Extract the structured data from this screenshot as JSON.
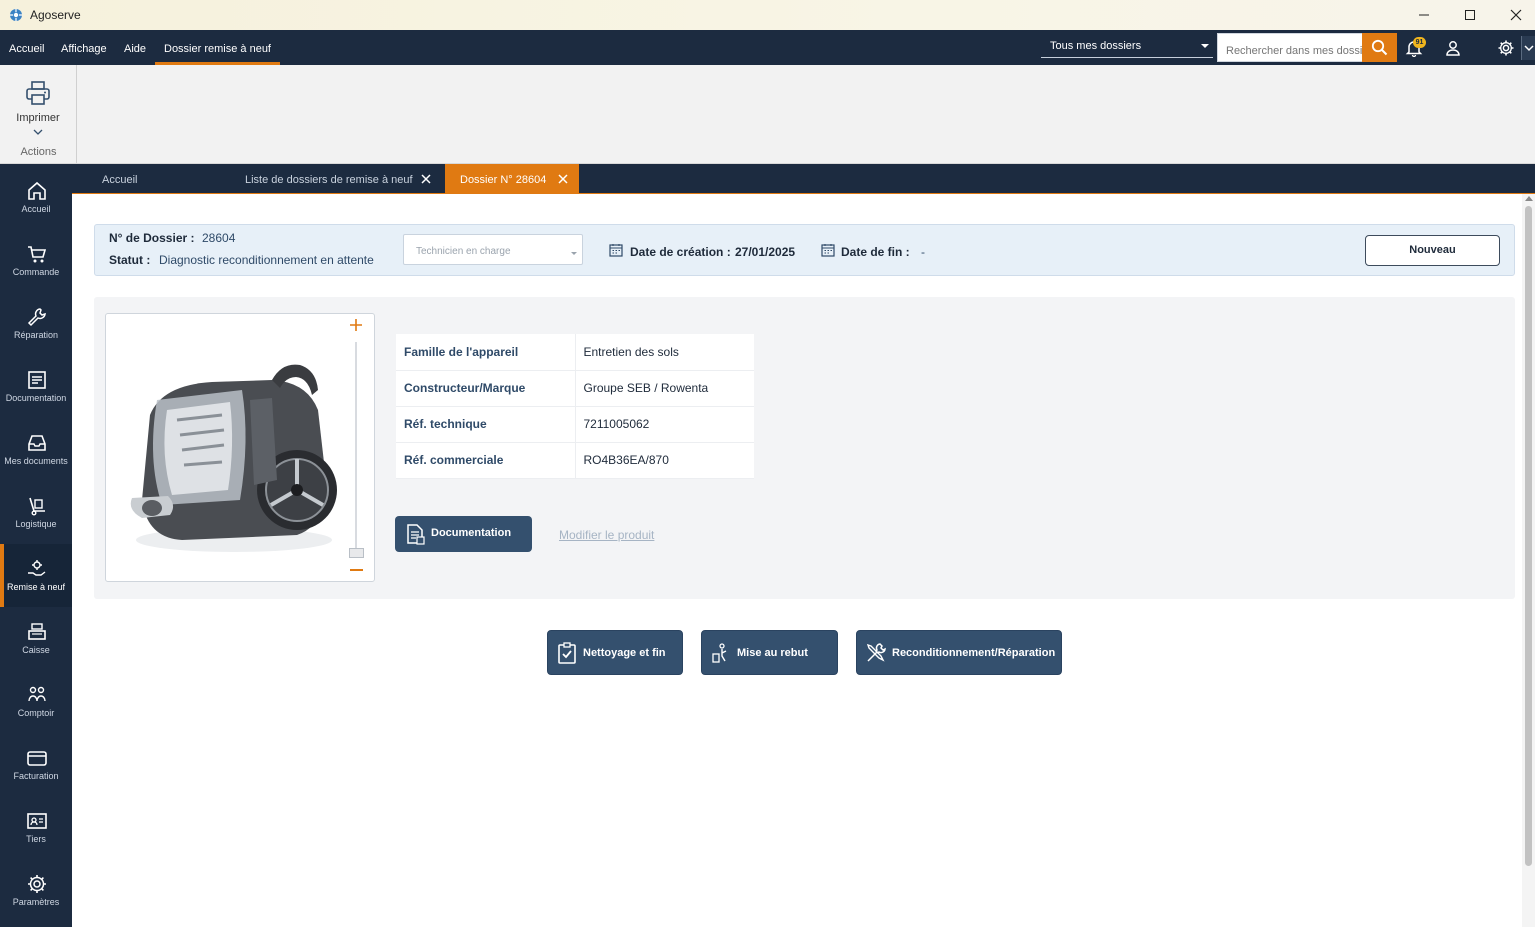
{
  "window": {
    "title": "Agoserve"
  },
  "menu": {
    "items": [
      "Accueil",
      "Affichage",
      "Aide",
      "Dossier remise à neuf"
    ]
  },
  "topbar": {
    "dossier_scope": "Tous mes dossiers",
    "search_placeholder": "Rechercher dans mes dossiers",
    "notification_count": "91"
  },
  "ribbon": {
    "print_label": "Imprimer",
    "group_label": "Actions"
  },
  "sidenav": {
    "items": [
      "Accueil",
      "Commande",
      "Réparation",
      "Documentation",
      "Mes documents",
      "Logistique",
      "Remise à neuf",
      "Caisse",
      "Comptoir",
      "Facturation",
      "Tiers",
      "Paramètres"
    ],
    "active": "Remise à neuf"
  },
  "tabs": [
    "Accueil",
    "Liste de dossiers de remise à neuf",
    "Dossier N° 28604"
  ],
  "dossier": {
    "number_label": "N° de Dossier :",
    "number": "28604",
    "status_label": "Statut :",
    "status": "Diagnostic reconditionnement en attente",
    "technician_placeholder": "Technicien en charge",
    "created_label": "Date de création :",
    "created": "27/01/2025",
    "end_label": "Date de fin :",
    "end": "-",
    "new_button": "Nouveau"
  },
  "product": {
    "specs": [
      {
        "label": "Famille de l'appareil",
        "value": "Entretien des sols"
      },
      {
        "label": "Constructeur/Marque",
        "value": "Groupe SEB / Rowenta"
      },
      {
        "label": "Réf. technique",
        "value": "7211005062"
      },
      {
        "label": "Réf. commerciale",
        "value": "RO4B36EA/870"
      }
    ],
    "documentation_button": "Documentation",
    "modify_link": "Modifier le produit",
    "image_zoom": 0.0
  },
  "actions": [
    "Nettoyage et fin",
    "Mise au rebut",
    "Reconditionnement/Réparation"
  ],
  "colors": {
    "navy": "#1c2b40",
    "accent": "#e07a12",
    "button": "#34506e",
    "header_bg": "#e7f0f8"
  }
}
